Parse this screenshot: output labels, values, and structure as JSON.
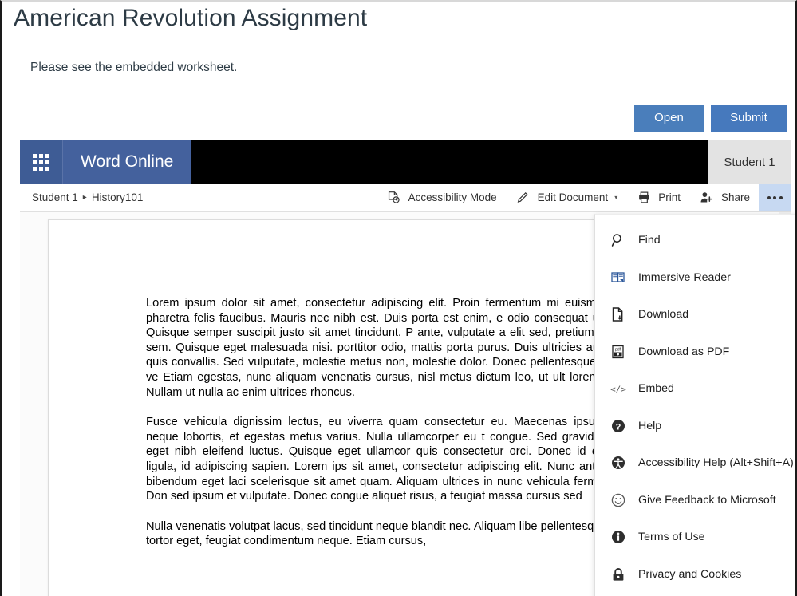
{
  "assignment": {
    "title": "American Revolution Assignment",
    "description": "Please see the embedded worksheet.",
    "open_label": "Open",
    "submit_label": "Submit"
  },
  "suite_bar": {
    "app_launcher_icon": "waffle-grid-icon",
    "brand": "Word Online",
    "user": "Student 1"
  },
  "command_bar": {
    "breadcrumb": {
      "owner": "Student 1",
      "separator": "▸",
      "folder": "History101"
    },
    "items": [
      {
        "label": "Accessibility Mode",
        "icon": "accessibility-mode-icon"
      },
      {
        "label": "Edit Document",
        "icon": "pencil-icon",
        "caret": "▾"
      },
      {
        "label": "Print",
        "icon": "printer-icon"
      },
      {
        "label": "Share",
        "icon": "share-person-icon"
      }
    ],
    "overflow_label": "•••"
  },
  "overflow_menu": {
    "items": [
      {
        "label": "Find",
        "icon": "search-icon"
      },
      {
        "label": "Immersive Reader",
        "icon": "immersive-reader-icon"
      },
      {
        "label": "Download",
        "icon": "download-icon"
      },
      {
        "label": "Download as PDF",
        "icon": "pdf-icon"
      },
      {
        "label": "Embed",
        "icon": "embed-code-icon"
      },
      {
        "label": "Help",
        "icon": "help-question-icon"
      },
      {
        "label": "Accessibility Help (Alt+Shift+A)",
        "icon": "accessibility-help-icon"
      },
      {
        "label": "Give Feedback to Microsoft",
        "icon": "smiley-icon"
      },
      {
        "label": "Terms of Use",
        "icon": "info-icon"
      },
      {
        "label": "Privacy and Cookies",
        "icon": "lock-icon"
      }
    ]
  },
  "document": {
    "paragraphs": [
      "Lorem ipsum dolor sit amet, consectetur adipiscing elit. Proin fermentum mi euismod, vel pharetra felis faucibus. Mauris nec nibh est. Duis porta est enim, e odio consequat ultrices. Quisque semper suscipit justo sit amet tincidunt. P ante, vulputate a elit sed, pretium cursus sem. Quisque eget malesuada nisi. porttitor odio, mattis porta purus. Duis ultricies at neque quis convallis. Sed vulputate, molestie metus non, molestie dolor. Donec pellentesque eu leo ve Etiam egestas, nunc aliquam venenatis cursus, nisl metus dictum leo, ut ult lorem in mi. Nullam ut nulla ac enim ultrices rhoncus.",
      "Fusce vehicula dignissim lectus, eu viverra quam consectetur eu. Maecenas ipsum quis neque lobortis, et egestas metus varius. Nulla ullamcorper eu t congue. Sed gravida lacus eget nibh eleifend luctus. Quisque eget ullamcor quis consectetur orci. Donec id eleifend ligula, id adipiscing sapien. Lorem ips sit amet, consectetur adipiscing elit. Nunc ante arcu, bibendum eget laci scelerisque sit amet quam. Aliquam ultrices in nunc vehicula fermentum. Don sed ipsum et vulputate. Donec congue aliquet risus, a feugiat massa cursus sed",
      "Nulla venenatis volutpat lacus, sed tincidunt neque blandit nec. Aliquam libe pellentesque eget tortor eget, feugiat condimentum neque. Etiam cursus,"
    ]
  },
  "colors": {
    "suite_brand_blue": "#44619D",
    "waffle_blue": "#3E5C95",
    "button_blue": "#4A7EBB",
    "overflow_active": "#C7D9F2",
    "title_text": "#2d3b45"
  }
}
